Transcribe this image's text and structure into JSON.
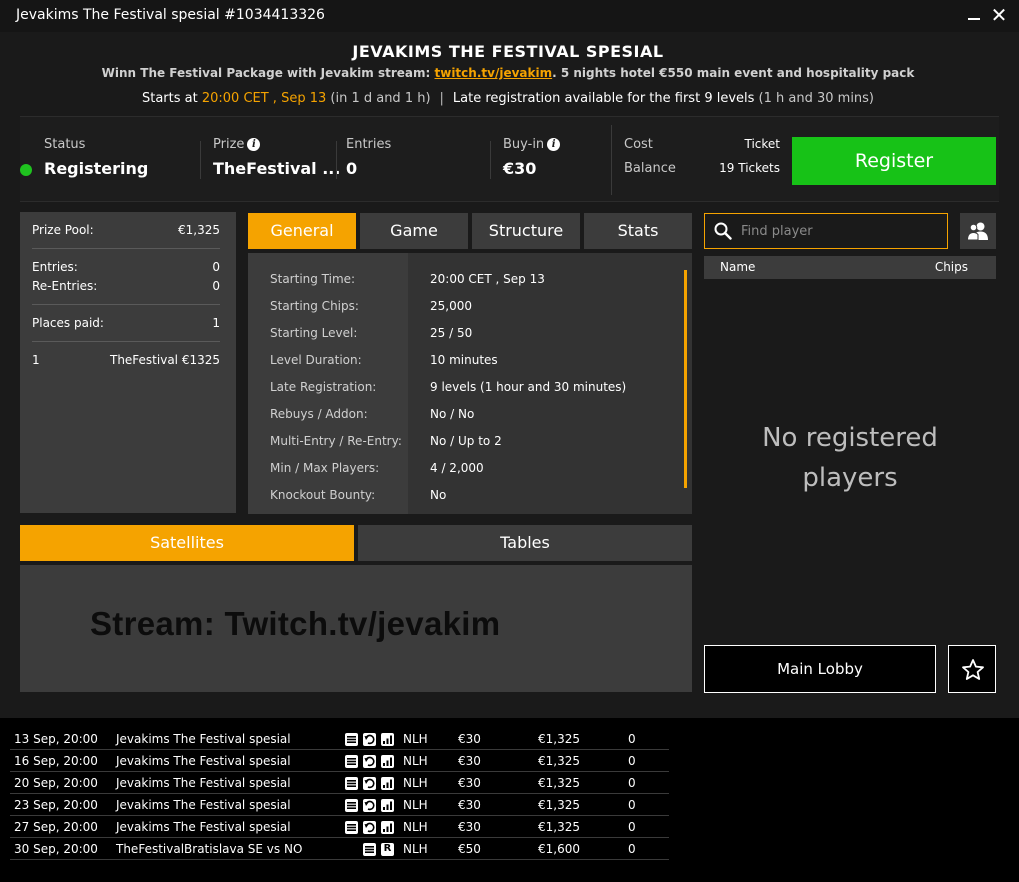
{
  "window": {
    "title": "Jevakims The Festival spesial #1034413326"
  },
  "header": {
    "title": "JEVAKIMS THE FESTIVAL SPESIAL",
    "subtitle_before": "Winn The Festival Package with Jevakim stream: ",
    "subtitle_link": "twitch.tv/jevakim",
    "subtitle_after": ". 5 nights hotel €550 main event and hospitality pack",
    "starts_prefix": "Starts at ",
    "starts_time": "20:00 CET , Sep 13",
    "starts_relative": " (in 1 d and 1 h)",
    "separator": "|",
    "late_reg": "Late registration available for the first 9 levels",
    "late_reg_duration": " (1 h and 30 mins)"
  },
  "infobar": {
    "status_label": "Status",
    "status_value": "Registering",
    "prize_label": "Prize",
    "prize_value": "TheFestival ...",
    "entries_label": "Entries",
    "entries_value": "0",
    "buyin_label": "Buy-in",
    "buyin_value": "€30",
    "cost_label": "Cost",
    "cost_value": "Ticket",
    "balance_label": "Balance",
    "balance_value": "19 Tickets",
    "register_label": "Register",
    "info_glyph": "i",
    "status_color": "#1fc31f",
    "register_color": "#17c217"
  },
  "summary": {
    "prize_pool_label": "Prize Pool:",
    "prize_pool_value": "€1,325",
    "entries_label": "Entries:",
    "entries_value": "0",
    "reentries_label": "Re-Entries:",
    "reentries_value": "0",
    "places_label": "Places paid:",
    "places_value": "1",
    "payout_place": "1",
    "payout_prize": "TheFestival €1325"
  },
  "tabs": [
    "General",
    "Game",
    "Structure",
    "Stats"
  ],
  "general": [
    {
      "k": "Starting Time:",
      "v": "20:00 CET , Sep 13"
    },
    {
      "k": "Starting Chips:",
      "v": "25,000"
    },
    {
      "k": "Starting Level:",
      "v": "25 / 50"
    },
    {
      "k": "Level Duration:",
      "v": "10 minutes"
    },
    {
      "k": "Late Registration:",
      "v": "9 levels (1 hour and 30 minutes)"
    },
    {
      "k": "Rebuys / Addon:",
      "v": "No / No"
    },
    {
      "k": "Multi-Entry / Re-Entry:",
      "v": "No / Up to 2"
    },
    {
      "k": "Min / Max Players:",
      "v": "4 / 2,000"
    },
    {
      "k": "Knockout Bounty:",
      "v": "No"
    }
  ],
  "players": {
    "search_placeholder": "Find player",
    "col_name": "Name",
    "col_chips": "Chips",
    "empty_line1": "No registered",
    "empty_line2": "players"
  },
  "bottom_tabs": [
    "Satellites",
    "Tables"
  ],
  "satellites": {
    "stream_text": "Stream: Twitch.tv/jevakim"
  },
  "actions": {
    "main_lobby": "Main Lobby"
  },
  "accent_color": "#f5a300",
  "tournaments": [
    {
      "date": "13 Sep, 20:00",
      "name": "Jevakims The Festival spesial",
      "icons": [
        "list-icon",
        "undo-icon",
        "chart-icon"
      ],
      "game": "NLH",
      "buyin": "€30",
      "prize": "€1,325",
      "entries": "0"
    },
    {
      "date": "16 Sep, 20:00",
      "name": "Jevakims The Festival spesial",
      "icons": [
        "list-icon",
        "undo-icon",
        "chart-icon"
      ],
      "game": "NLH",
      "buyin": "€30",
      "prize": "€1,325",
      "entries": "0"
    },
    {
      "date": "20 Sep, 20:00",
      "name": "Jevakims The Festival spesial",
      "icons": [
        "list-icon",
        "undo-icon",
        "chart-icon"
      ],
      "game": "NLH",
      "buyin": "€30",
      "prize": "€1,325",
      "entries": "0"
    },
    {
      "date": "23 Sep, 20:00",
      "name": "Jevakims The Festival spesial",
      "icons": [
        "list-icon",
        "undo-icon",
        "chart-icon"
      ],
      "game": "NLH",
      "buyin": "€30",
      "prize": "€1,325",
      "entries": "0"
    },
    {
      "date": "27 Sep, 20:00",
      "name": "Jevakims The Festival spesial",
      "icons": [
        "list-icon",
        "undo-icon",
        "chart-icon"
      ],
      "game": "NLH",
      "buyin": "€30",
      "prize": "€1,325",
      "entries": "0"
    },
    {
      "date": "30 Sep, 20:00",
      "name": "TheFestivalBratislava SE vs NO",
      "icons": [
        "list-icon",
        "rebuy-icon"
      ],
      "rebuy_letter": "R",
      "game": "NLH",
      "buyin": "€50",
      "prize": "€1,600",
      "entries": "0"
    }
  ]
}
